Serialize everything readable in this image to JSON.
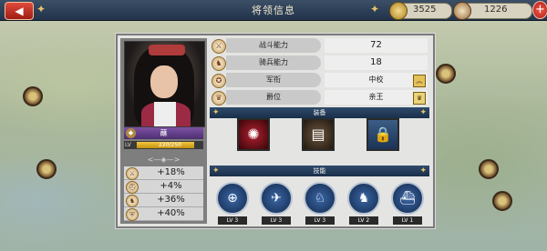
{
  "header": {
    "back_icon": "back-arrow-icon",
    "title": "将领信息",
    "coin_value": "3525",
    "scroll_value": "1226",
    "add_icon": "plus-icon"
  },
  "general": {
    "name": "蘸",
    "level_label": "LV",
    "xp_text": "220/250",
    "xp_fraction": 0.88,
    "stats": [
      "+18%",
      "+4%",
      "+36%",
      "+40%"
    ]
  },
  "attributes": [
    {
      "label": "战斗能力",
      "value": "72"
    },
    {
      "label": "骑兵能力",
      "value": "18"
    },
    {
      "label": "军衔",
      "value": "中校"
    },
    {
      "label": "爵位",
      "value": "亲王"
    }
  ],
  "equipment": {
    "title": "装备",
    "slots": [
      {
        "icon": "red-claw-weapon-icon"
      },
      {
        "icon": "armor-chest-icon"
      },
      {
        "icon": "lock-icon"
      }
    ]
  },
  "skills": {
    "title": "技能",
    "items": [
      {
        "icon": "crosshair-icon",
        "level": "LV 3"
      },
      {
        "icon": "cannon-soldier-icon",
        "level": "LV 3"
      },
      {
        "icon": "cavalry-charge-icon",
        "level": "LV 3"
      },
      {
        "icon": "rider-icon",
        "level": "LV 2"
      },
      {
        "icon": "warship-icon",
        "level": "LV 1"
      }
    ]
  },
  "colors": {
    "topbar": "#2b3d55",
    "accent_gold": "#e6c46a",
    "name_bar": "#6a4394",
    "skill_circle": "#2a5596"
  }
}
